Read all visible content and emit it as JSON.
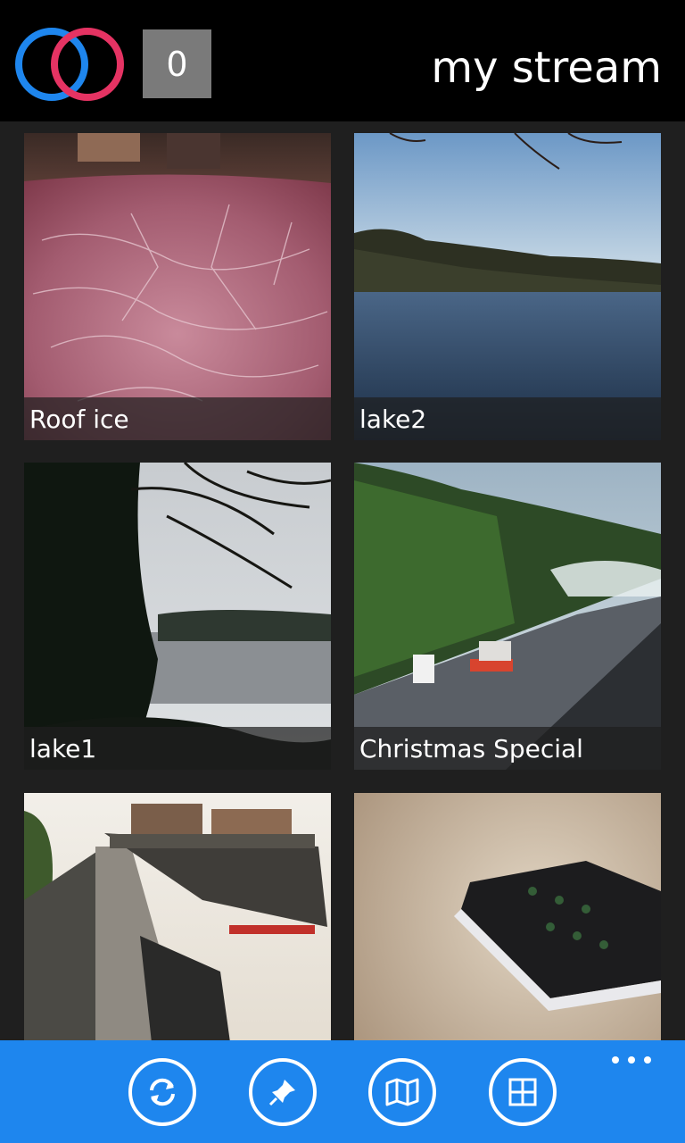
{
  "header": {
    "logo_icon": "flickr-logo-icon",
    "counter_value": "0",
    "title": "my stream"
  },
  "photos": [
    {
      "caption": "Roof ice",
      "scene": "frost crystals on red roof"
    },
    {
      "caption": "lake2",
      "scene": "lake with blue sky"
    },
    {
      "caption": "lake1",
      "scene": "lake framed by dark trees"
    },
    {
      "caption": "Christmas Special",
      "scene": "railway platform with trees"
    },
    {
      "caption": "",
      "scene": "station with train carriages"
    },
    {
      "caption": "",
      "scene": "phone on stone surface"
    }
  ],
  "appbar": {
    "buttons": [
      {
        "icon": "refresh-icon"
      },
      {
        "icon": "pin-icon"
      },
      {
        "icon": "map-icon"
      },
      {
        "icon": "tiles-icon"
      }
    ],
    "more_icon": "more-dots-icon"
  },
  "colors": {
    "header_bg": "#000000",
    "page_bg": "#1f1f1f",
    "appbar_bg": "#1e86ee",
    "logo_blue": "#1e86ee",
    "logo_pink": "#e53363"
  }
}
